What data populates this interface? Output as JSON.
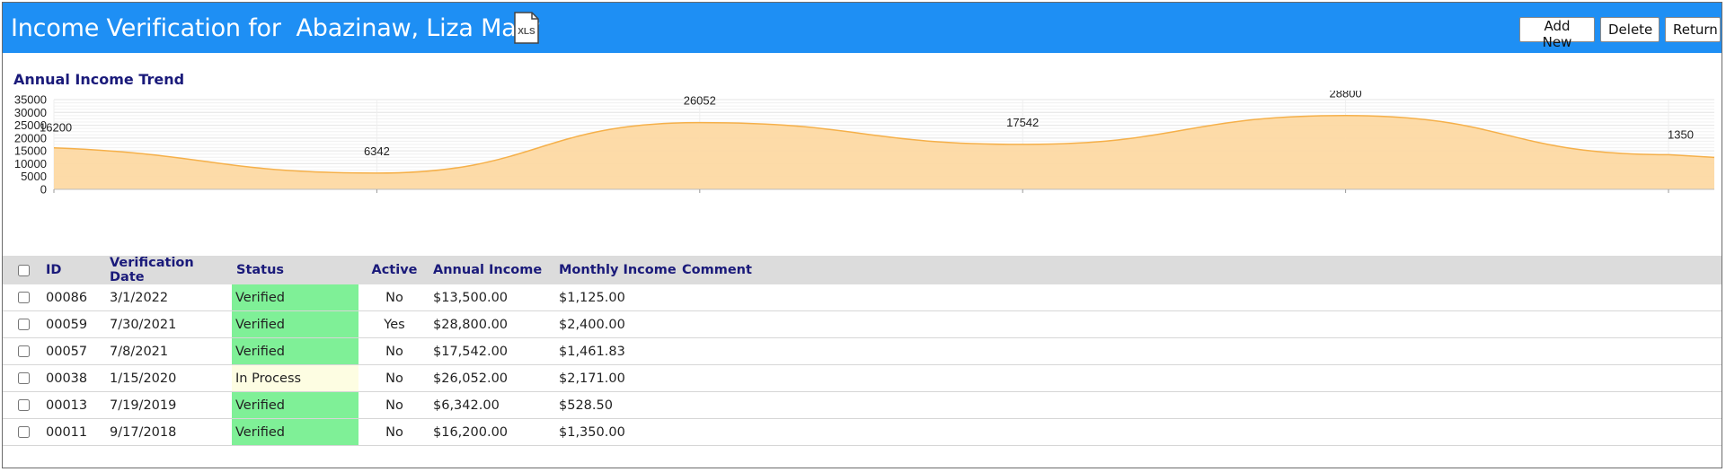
{
  "header": {
    "title": "Income Verification for  Abazinaw, Liza Mary",
    "export_icon_label": "XLS",
    "buttons": {
      "add_new": "Add New",
      "delete": "Delete",
      "return": "Return"
    }
  },
  "colors": {
    "header_bg": "#1e8ff4",
    "area_fill": "#fdd9a3",
    "area_line": "#f5b04a",
    "verified": "#7ff097",
    "in_process": "#fdfde2",
    "heading_text": "#1a1a7a"
  },
  "chart_data": {
    "type": "area",
    "title": "Annual Income Trend",
    "smooth": true,
    "ylim": [
      0,
      35000
    ],
    "yticks": [
      0,
      5000,
      10000,
      15000,
      20000,
      25000,
      30000,
      35000
    ],
    "grid": true,
    "series": [
      {
        "values": [
          16200,
          6342,
          26052,
          17542,
          28800,
          13500
        ],
        "labels": [
          "16200",
          "6342",
          "26052",
          "17542",
          "28800",
          "1350"
        ]
      }
    ]
  },
  "table": {
    "columns": [
      "ID",
      "Verification Date",
      "Status",
      "Active",
      "Annual Income",
      "Monthly Income",
      "Comment"
    ],
    "rows": [
      {
        "id": "00086",
        "date": "3/1/2022",
        "status": "Verified",
        "active": "No",
        "annual": "$13,500.00",
        "monthly": "$1,125.00",
        "comment": ""
      },
      {
        "id": "00059",
        "date": "7/30/2021",
        "status": "Verified",
        "active": "Yes",
        "annual": "$28,800.00",
        "monthly": "$2,400.00",
        "comment": ""
      },
      {
        "id": "00057",
        "date": "7/8/2021",
        "status": "Verified",
        "active": "No",
        "annual": "$17,542.00",
        "monthly": "$1,461.83",
        "comment": ""
      },
      {
        "id": "00038",
        "date": "1/15/2020",
        "status": "In Process",
        "active": "No",
        "annual": "$26,052.00",
        "monthly": "$2,171.00",
        "comment": ""
      },
      {
        "id": "00013",
        "date": "7/19/2019",
        "status": "Verified",
        "active": "No",
        "annual": "$6,342.00",
        "monthly": "$528.50",
        "comment": ""
      },
      {
        "id": "00011",
        "date": "9/17/2018",
        "status": "Verified",
        "active": "No",
        "annual": "$16,200.00",
        "monthly": "$1,350.00",
        "comment": ""
      }
    ]
  }
}
